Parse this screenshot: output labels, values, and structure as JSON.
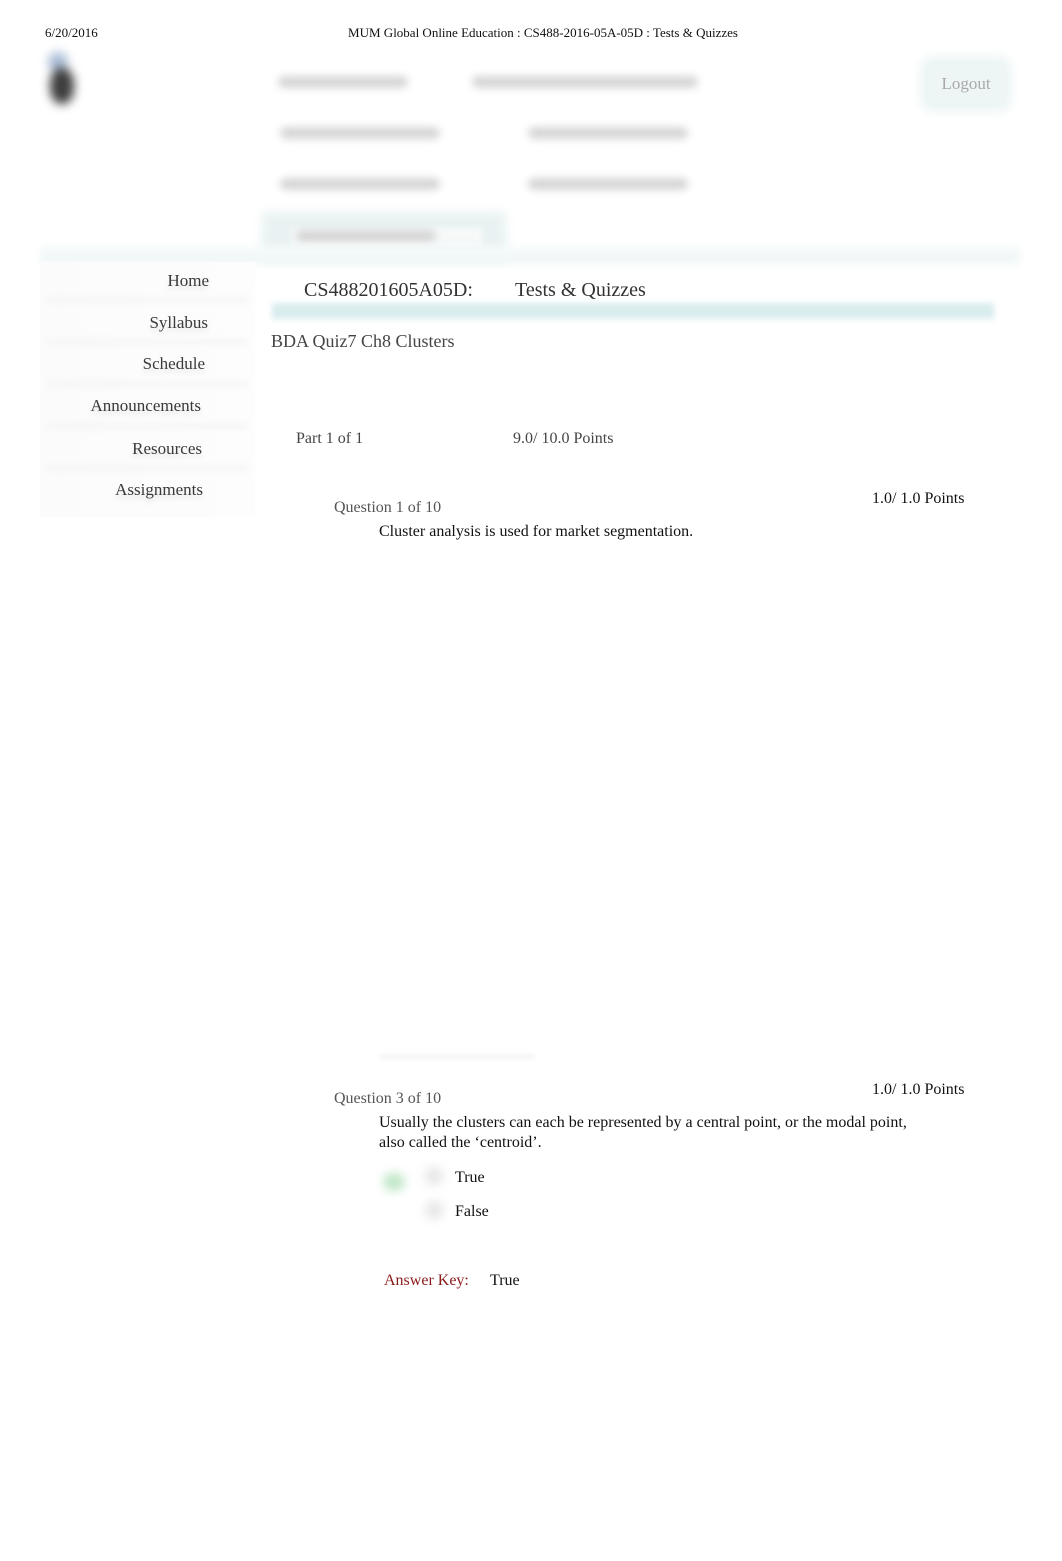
{
  "print_header": {
    "date": "6/20/2016",
    "title": "MUM Global Online Education : CS488-2016-05A-05D : Tests & Quizzes"
  },
  "header": {
    "logo_icon": "institution-logo-icon",
    "logout_label": "Logout"
  },
  "sidebar": {
    "items": [
      {
        "label": "Home"
      },
      {
        "label": "Syllabus"
      },
      {
        "label": "Schedule"
      },
      {
        "label": "Announcements"
      },
      {
        "label": "Resources"
      },
      {
        "label": "Assignments"
      }
    ]
  },
  "main": {
    "site_title": "CS488201605A05D:",
    "tool_title": "Tests & Quizzes",
    "quiz_title": "BDA Quiz7 Ch8  Clusters",
    "part": {
      "label": "Part 1 of 1",
      "points": "9.0/ 10.0 Points"
    },
    "questions": [
      {
        "label": "Question 1 of 10",
        "points": "1.0/ 1.0 Points",
        "text": "Cluster analysis is used for market segmentation."
      },
      {
        "label": "Question 3 of 10",
        "points": "1.0/ 1.0 Points",
        "text": "Usually the clusters can each be represented by a central point, or the modal point, also called the ‘centroid’.",
        "options": [
          {
            "label": "True",
            "selected": true,
            "correct_icon": "checkmark-icon"
          },
          {
            "label": "False",
            "selected": false
          }
        ],
        "answer_key_label": "Answer Key:",
        "answer_key_value": "True"
      }
    ]
  },
  "colors": {
    "answer_key": "#8b1a1a",
    "title_band": "#d9ecee",
    "correct_mark": "#bfe6c6"
  }
}
